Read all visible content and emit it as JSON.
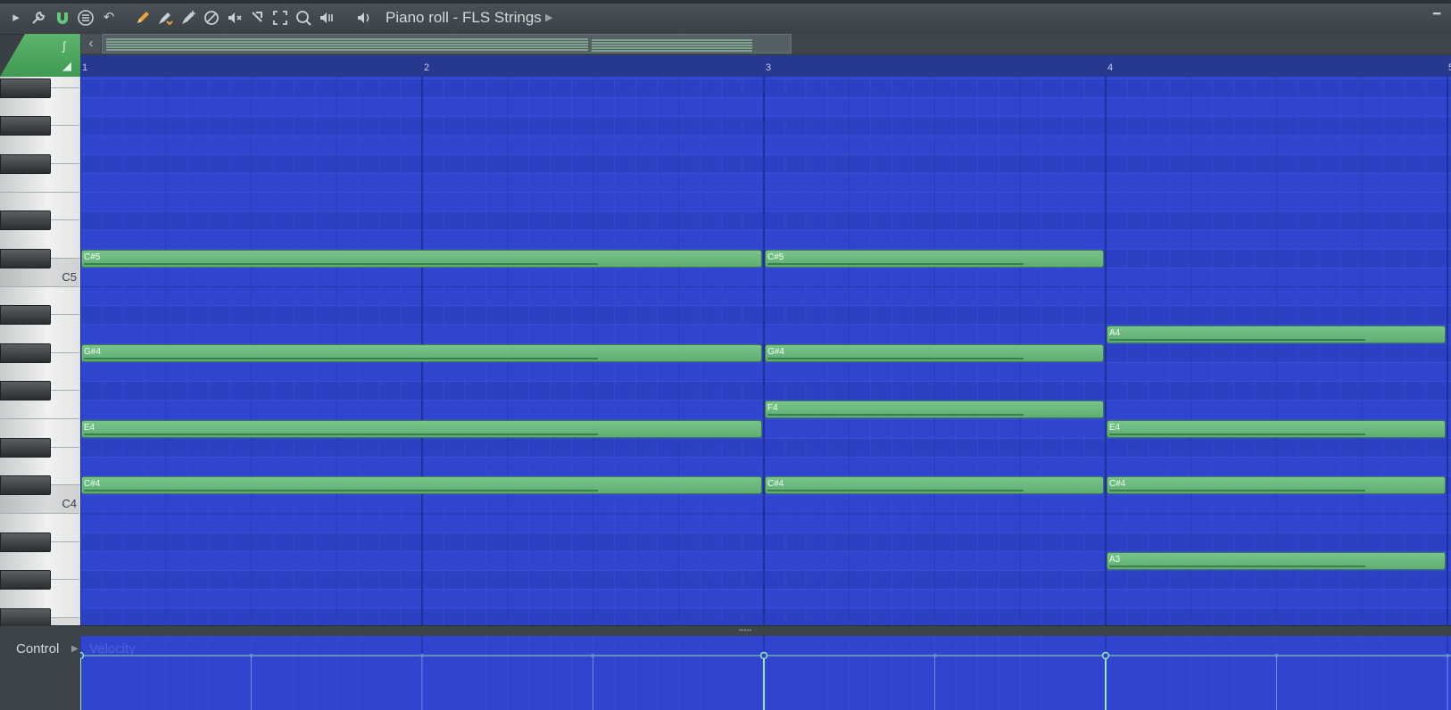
{
  "toolbar": {
    "title": "Piano roll - FLS Strings",
    "icons": [
      "play-arrow-icon",
      "wrench-icon",
      "magnet-icon",
      "menu-icon",
      "undo-icon",
      "pencil-icon",
      "paint-icon",
      "paint-add-icon",
      "delete-icon",
      "mute-icon",
      "slip-icon",
      "select-icon",
      "zoom-icon",
      "playback-icon",
      "speaker-icon"
    ]
  },
  "ruler": {
    "bars": [
      "1",
      "2",
      "3",
      "4",
      "5"
    ]
  },
  "keyboard": {
    "labels": {
      "c5": "C5",
      "c4": "C4"
    }
  },
  "notes": [
    {
      "label": "C#5",
      "start": 1,
      "end": 3
    },
    {
      "label": "C#5",
      "start": 3,
      "end": 4
    },
    {
      "label": "A4",
      "start": 4,
      "end": 5
    },
    {
      "label": "G#4",
      "start": 1,
      "end": 3
    },
    {
      "label": "G#4",
      "start": 3,
      "end": 4
    },
    {
      "label": "F4",
      "start": 3,
      "end": 4
    },
    {
      "label": "E4",
      "start": 1,
      "end": 3
    },
    {
      "label": "E4",
      "start": 4,
      "end": 5
    },
    {
      "label": "C#4",
      "start": 1,
      "end": 3
    },
    {
      "label": "C#4",
      "start": 3,
      "end": 4
    },
    {
      "label": "C#4",
      "start": 4,
      "end": 5
    },
    {
      "label": "A3",
      "start": 4,
      "end": 5
    }
  ],
  "control": {
    "label": "Control",
    "target": "Velocity"
  },
  "colors": {
    "grid_bg": "#2f45cf",
    "note": "#6bb87e",
    "accent_green": "#4fad62"
  }
}
